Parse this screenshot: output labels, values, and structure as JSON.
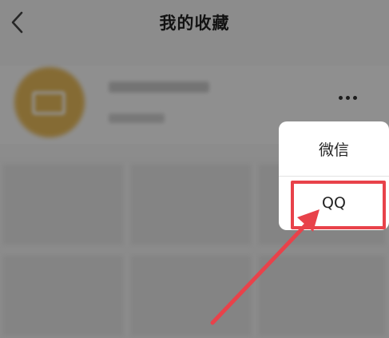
{
  "header": {
    "title": "我的收藏",
    "back_icon": "chevron-left-icon"
  },
  "favorites": {
    "more_icon": "more-horizontal-icon"
  },
  "share_menu": {
    "items": [
      {
        "label": "微信"
      },
      {
        "label": "QQ"
      }
    ]
  },
  "colors": {
    "annotation_red": "#e8424a",
    "folder_accent": "#e6b95a",
    "title_text": "#222222"
  }
}
